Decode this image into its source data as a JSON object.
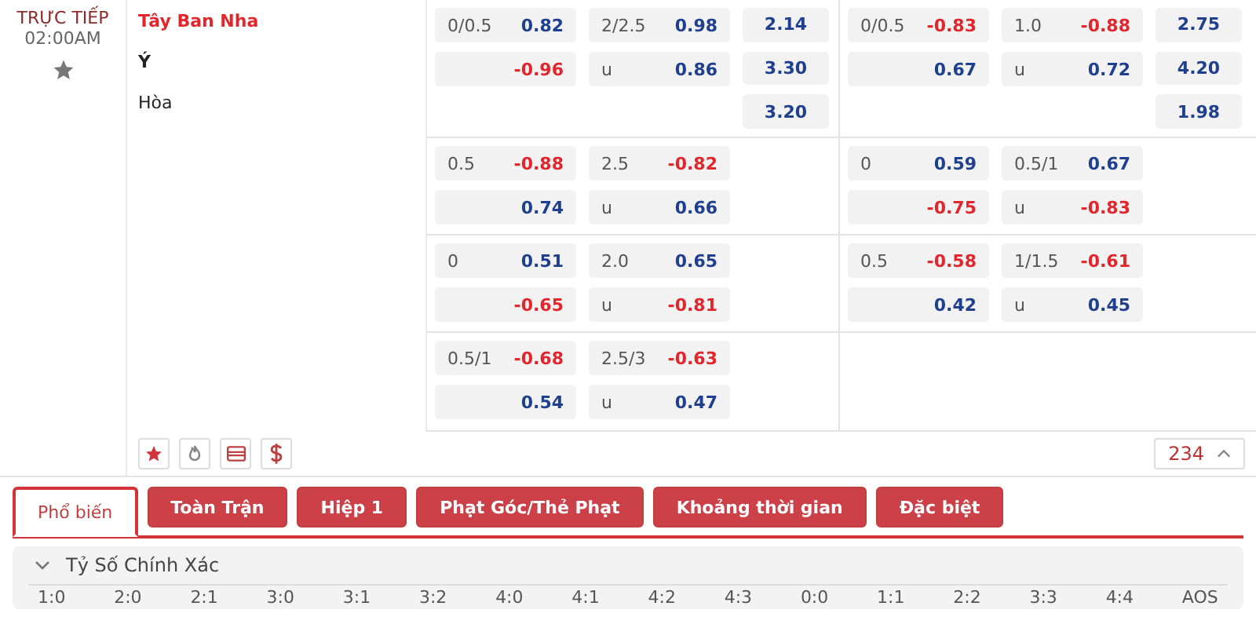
{
  "match": {
    "status": "TRỰC TIẾP",
    "time": "02:00AM",
    "favorite": false,
    "teams": [
      {
        "name": "Tây Ban Nha",
        "highlighted": true
      },
      {
        "name": "Ý",
        "highlighted": false
      },
      {
        "name": "Hòa",
        "highlighted": false
      }
    ]
  },
  "markets": [
    {
      "rows": [
        {
          "handicap": [
            {
              "line": "0/0.5",
              "odds": "0.82",
              "color": "#1f3f8f"
            },
            {
              "odds": "-0.96",
              "color": "#e3262b"
            }
          ],
          "over_under": [
            {
              "line": "2/2.5",
              "odds": "0.98",
              "color": "#1f3f8f"
            },
            {
              "line": "u",
              "odds": "0.86",
              "color": "#1f3f8f"
            }
          ],
          "one_x_two": [
            "2.14",
            "3.30",
            "3.20"
          ]
        },
        {
          "handicap": [
            {
              "line": "0.5",
              "odds": "-0.88",
              "color": "#e3262b"
            },
            {
              "odds": "0.74",
              "color": "#1f3f8f"
            }
          ],
          "over_under": [
            {
              "line": "2.5",
              "odds": "-0.82",
              "color": "#e3262b"
            },
            {
              "line": "u",
              "odds": "0.66",
              "color": "#1f3f8f"
            }
          ]
        },
        {
          "handicap": [
            {
              "line": "0",
              "odds": "0.51",
              "color": "#1f3f8f"
            },
            {
              "odds": "-0.65",
              "color": "#e3262b"
            }
          ],
          "over_under": [
            {
              "line": "2.0",
              "odds": "0.65",
              "color": "#1f3f8f"
            },
            {
              "line": "u",
              "odds": "-0.81",
              "color": "#e3262b"
            }
          ]
        },
        {
          "handicap": [
            {
              "line": "0.5/1",
              "odds": "-0.68",
              "color": "#e3262b"
            },
            {
              "odds": "0.54",
              "color": "#1f3f8f"
            }
          ],
          "over_under": [
            {
              "line": "2.5/3",
              "odds": "-0.63",
              "color": "#e3262b"
            },
            {
              "line": "u",
              "odds": "0.47",
              "color": "#1f3f8f"
            }
          ]
        }
      ]
    },
    {
      "rows": [
        {
          "handicap": [
            {
              "line": "0/0.5",
              "odds": "-0.83",
              "color": "#e3262b"
            },
            {
              "odds": "0.67",
              "color": "#1f3f8f"
            }
          ],
          "over_under": [
            {
              "line": "1.0",
              "odds": "-0.88",
              "color": "#e3262b"
            },
            {
              "line": "u",
              "odds": "0.72",
              "color": "#1f3f8f"
            }
          ],
          "one_x_two": [
            "2.75",
            "4.20",
            "1.98"
          ]
        },
        {
          "handicap": [
            {
              "line": "0",
              "odds": "0.59",
              "color": "#1f3f8f"
            },
            {
              "odds": "-0.75",
              "color": "#e3262b"
            }
          ],
          "over_under": [
            {
              "line": "0.5/1",
              "odds": "0.67",
              "color": "#1f3f8f"
            },
            {
              "line": "u",
              "odds": "-0.83",
              "color": "#e3262b"
            }
          ]
        },
        {
          "handicap": [
            {
              "line": "0.5",
              "odds": "-0.58",
              "color": "#e3262b"
            },
            {
              "odds": "0.42",
              "color": "#1f3f8f"
            }
          ],
          "over_under": [
            {
              "line": "1/1.5",
              "odds": "-0.61",
              "color": "#e3262b"
            },
            {
              "line": "u",
              "odds": "0.45",
              "color": "#1f3f8f"
            }
          ]
        }
      ]
    }
  ],
  "tools": [
    {
      "kind": "star"
    },
    {
      "kind": "fire"
    },
    {
      "kind": "ticket"
    },
    {
      "kind": "dollar"
    }
  ],
  "more_count": {
    "label": "234",
    "expanded": true
  },
  "tabs": [
    {
      "label": "Phổ biến",
      "selected": true
    },
    {
      "label": "Toàn Trận",
      "selected": false
    },
    {
      "label": "Hiệp 1",
      "selected": false
    },
    {
      "label": "Phạt Góc/Thẻ Phạt",
      "selected": false
    },
    {
      "label": "Khoảng thời gian",
      "selected": false
    },
    {
      "label": "Đặc biệt",
      "selected": false
    }
  ],
  "section": {
    "title": "Tỷ Số Chính Xác",
    "expanded": true,
    "scores": [
      "1:0",
      "2:0",
      "2:1",
      "3:0",
      "3:1",
      "3:2",
      "4:0",
      "4:1",
      "4:2",
      "4:3",
      "0:0",
      "1:1",
      "2:2",
      "3:3",
      "4:4",
      "AOS"
    ]
  }
}
